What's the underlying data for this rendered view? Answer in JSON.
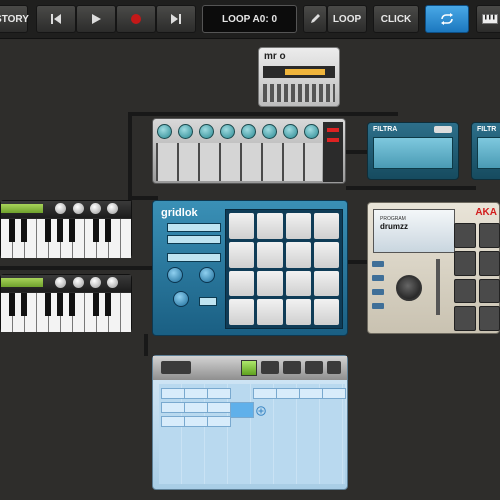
{
  "toolbar": {
    "history_label": "STORY",
    "loop_display": "LOOP A0: 0",
    "loop_label": "LOOP",
    "click_label": "CLICK"
  },
  "devices": {
    "mro": {
      "logo": "mr o"
    },
    "filtra": [
      {
        "label": "FILTRA"
      },
      {
        "label": "FILTR"
      }
    ],
    "gridlok": {
      "name": "gridlok"
    },
    "akai": {
      "brand": "AKA",
      "program_label": "PROGRAM",
      "program_name": "drumzz"
    }
  },
  "colors": {
    "accent": "#2a8fd8",
    "gridlok": "#2a7ca6",
    "record": "#c41818",
    "akai_brand": "#d21c1c"
  }
}
